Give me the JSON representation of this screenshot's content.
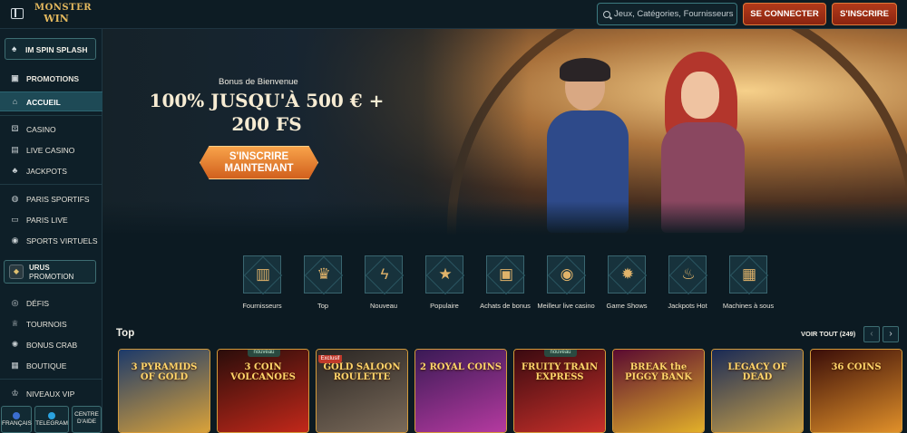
{
  "header": {
    "logo_line1": "MONSTER",
    "logo_line2": "WIN",
    "search_placeholder": "Jeux, Catégories, Fournisseurs",
    "login_label": "SE CONNECTER",
    "signup_label": "S'INSCRIRE"
  },
  "sidebar": {
    "promo_top": "IM SPIN SPLASH",
    "items": [
      {
        "label": "PROMOTIONS",
        "icon": "gift-icon"
      },
      {
        "label": "ACCUEIL",
        "icon": "home-icon",
        "active": true
      },
      {
        "label": "CASINO",
        "icon": "dice-icon"
      },
      {
        "label": "LIVE CASINO",
        "icon": "cards-icon"
      },
      {
        "label": "JACKPOTS",
        "icon": "clover-icon"
      },
      {
        "label": "PARIS SPORTIFS",
        "icon": "ball-icon"
      },
      {
        "label": "PARIS LIVE",
        "icon": "live-icon"
      },
      {
        "label": "SPORTS VIRTUELS",
        "icon": "virtual-icon"
      },
      {
        "label": "DÉFIS",
        "icon": "target-icon"
      },
      {
        "label": "TOURNOIS",
        "icon": "trophy-icon"
      },
      {
        "label": "BONUS CRAB",
        "icon": "crab-icon"
      },
      {
        "label": "BOUTIQUE",
        "icon": "shop-icon"
      },
      {
        "label": "NIVEAUX VIP",
        "icon": "crown-icon"
      }
    ],
    "urus_title": "URUS",
    "urus_sub": "PROMOTION",
    "footer": {
      "language": "FRANÇAIS",
      "telegram": "TELEGRAM",
      "help_line1": "CENTRE",
      "help_line2": "D'AIDE"
    }
  },
  "hero": {
    "subtitle": "Bonus de Bienvenue",
    "title": "100% JUSQU'À 500 € + 200 FS",
    "cta": "S'INSCRIRE MAINTENANT"
  },
  "categories": [
    {
      "label": "Fournisseurs",
      "icon": "book-icon"
    },
    {
      "label": "Top",
      "icon": "crown-icon"
    },
    {
      "label": "Nouveau",
      "icon": "lightning-icon"
    },
    {
      "label": "Populaire",
      "icon": "star-icon"
    },
    {
      "label": "Achats de bonus",
      "icon": "chest-icon"
    },
    {
      "label": "Meilleur live casino",
      "icon": "chip-icon"
    },
    {
      "label": "Game Shows",
      "icon": "wheel-icon"
    },
    {
      "label": "Jackpots Hot",
      "icon": "flame-icon"
    },
    {
      "label": "Machines à sous",
      "icon": "slot-machine-icon"
    }
  ],
  "top_section": {
    "title": "Top",
    "view_all": "VOIR TOUT (249)"
  },
  "games": [
    {
      "title": "3 PYRAMIDS OF GOLD",
      "tag": "",
      "colors": [
        "#1d3a6a",
        "#d9a23a"
      ]
    },
    {
      "title": "3 COIN VOLCANOES",
      "tag": "nouveau",
      "colors": [
        "#2a0d0a",
        "#c2281a"
      ]
    },
    {
      "title": "GOLD SALOON ROULETTE",
      "tag": "Exclusif",
      "colors": [
        "#2a2623",
        "#7a6a5a"
      ]
    },
    {
      "title": "2 ROYAL COINS",
      "tag": "",
      "colors": [
        "#3a1a55",
        "#b53aa0"
      ]
    },
    {
      "title": "FRUITY TRAIN EXPRESS",
      "tag": "nouveau",
      "colors": [
        "#3a0a10",
        "#c8302a"
      ]
    },
    {
      "title": "BREAK the PIGGY BANK",
      "tag": "",
      "colors": [
        "#5a0a30",
        "#e2b02a"
      ]
    },
    {
      "title": "LEGACY OF DEAD",
      "tag": "",
      "colors": [
        "#1a2a55",
        "#c9a24a"
      ]
    },
    {
      "title": "36 COINS",
      "tag": "",
      "colors": [
        "#3a0d08",
        "#e0902a"
      ]
    }
  ]
}
